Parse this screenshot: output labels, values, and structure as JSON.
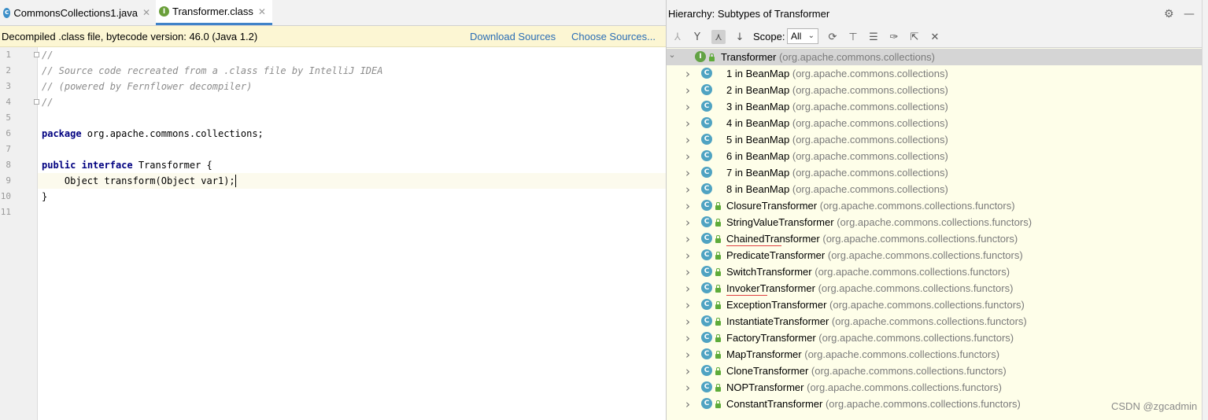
{
  "editor": {
    "tabs": [
      {
        "label": "CommonsCollections1.java",
        "icon": "class-file-icon",
        "active": false
      },
      {
        "label": "Transformer.class",
        "icon": "interface-file-icon",
        "active": true
      }
    ],
    "banner": {
      "message": "Decompiled .class file, bytecode version: 46.0 (Java 1.2)",
      "download_sources": "Download Sources",
      "choose_sources": "Choose Sources..."
    },
    "line_numbers": [
      "1",
      "2",
      "3",
      "4",
      "5",
      "6",
      "7",
      "8",
      "9",
      "10",
      "11"
    ],
    "code": {
      "l1": "//",
      "l2": "// Source code recreated from a .class file by IntelliJ IDEA",
      "l3": "// (powered by Fernflower decompiler)",
      "l4": "//",
      "l6_kw": "package",
      "l6_rest": " org.apache.commons.collections;",
      "l8_kw1": "public",
      "l8_kw2": "interface",
      "l8_rest": " Transformer {",
      "l9": "    Object transform(Object var1);",
      "l10": "}"
    }
  },
  "hierarchy": {
    "header_title": "Hierarchy:  Subtypes of Transformer",
    "scope_label": "Scope:",
    "scope_value": "All",
    "root": {
      "name": "Transformer",
      "pkg": "(org.apache.commons.collections)"
    },
    "items": [
      {
        "name": "1 in BeanMap",
        "pkg": "(org.apache.commons.collections)"
      },
      {
        "name": "2 in BeanMap",
        "pkg": "(org.apache.commons.collections)"
      },
      {
        "name": "3 in BeanMap",
        "pkg": "(org.apache.commons.collections)"
      },
      {
        "name": "4 in BeanMap",
        "pkg": "(org.apache.commons.collections)"
      },
      {
        "name": "5 in BeanMap",
        "pkg": "(org.apache.commons.collections)"
      },
      {
        "name": "6 in BeanMap",
        "pkg": "(org.apache.commons.collections)"
      },
      {
        "name": "7 in BeanMap",
        "pkg": "(org.apache.commons.collections)"
      },
      {
        "name": "8 in BeanMap",
        "pkg": "(org.apache.commons.collections)"
      },
      {
        "name": "ClosureTransformer",
        "pkg": "(org.apache.commons.collections.functors)"
      },
      {
        "name": "StringValueTransformer",
        "pkg": "(org.apache.commons.collections.functors)"
      },
      {
        "name": "ChainedTransformer",
        "pkg": "(org.apache.commons.collections.functors)"
      },
      {
        "name": "PredicateTransformer",
        "pkg": "(org.apache.commons.collections.functors)"
      },
      {
        "name": "SwitchTransformer",
        "pkg": "(org.apache.commons.collections.functors)"
      },
      {
        "name": "InvokerTransformer",
        "pkg": "(org.apache.commons.collections.functors)"
      },
      {
        "name": "ExceptionTransformer",
        "pkg": "(org.apache.commons.collections.functors)"
      },
      {
        "name": "InstantiateTransformer",
        "pkg": "(org.apache.commons.collections.functors)"
      },
      {
        "name": "FactoryTransformer",
        "pkg": "(org.apache.commons.collections.functors)"
      },
      {
        "name": "MapTransformer",
        "pkg": "(org.apache.commons.collections.functors)"
      },
      {
        "name": "CloneTransformer",
        "pkg": "(org.apache.commons.collections.functors)"
      },
      {
        "name": "NOPTransformer",
        "pkg": "(org.apache.commons.collections.functors)"
      },
      {
        "name": "ConstantTransformer",
        "pkg": "(org.apache.commons.collections.functors)"
      }
    ]
  },
  "watermark": "CSDN @zgcadmin",
  "colors": {
    "accent": "#4083c9",
    "link": "#2a6db5",
    "banner": "#fcf6d3",
    "tree_bg": "#fefee9"
  }
}
